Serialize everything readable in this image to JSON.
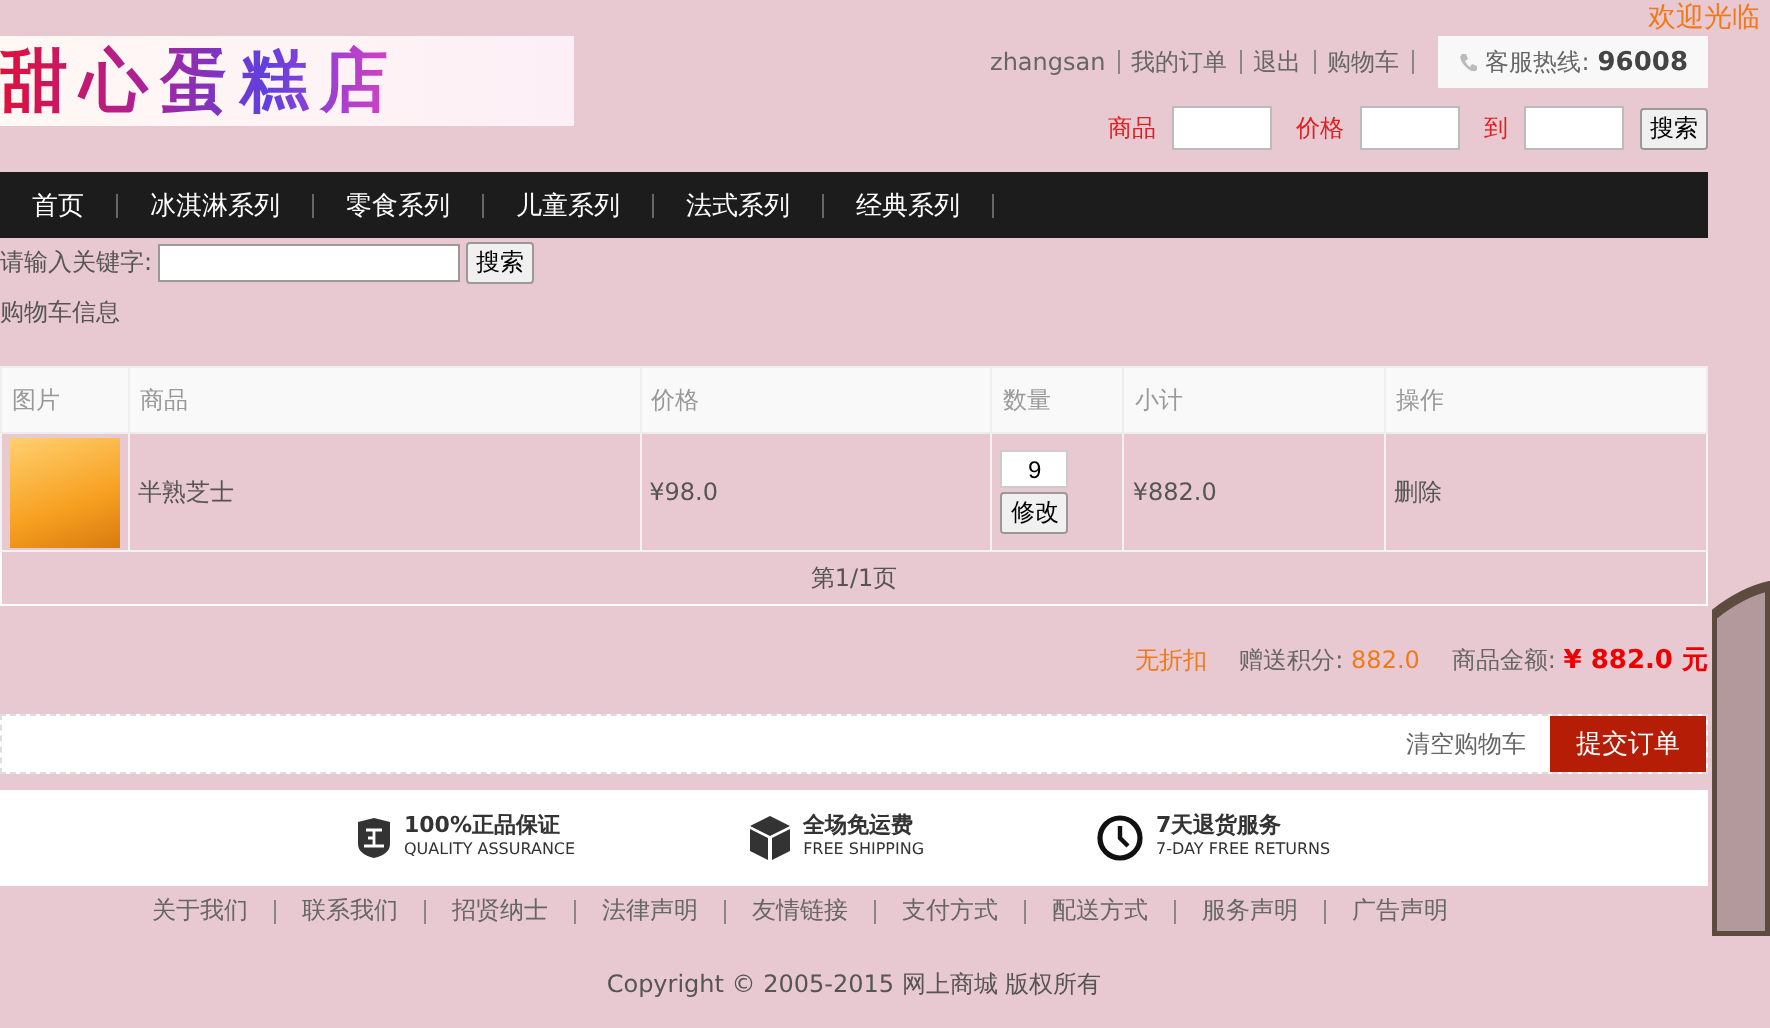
{
  "welcome": "欢迎光临",
  "logo": "甜心蛋糕店",
  "top_links": [
    "zhangsan",
    "我的订单",
    "退出",
    "购物车"
  ],
  "hotline": {
    "label": "客服热线:",
    "number": "96008"
  },
  "price_search": {
    "product_label": "商品",
    "price_label": "价格",
    "to_label": "到",
    "button": "搜索"
  },
  "nav": [
    {
      "label": "首页",
      "selected": false
    },
    {
      "label": "冰淇淋系列",
      "selected": false
    },
    {
      "label": "零食系列",
      "selected": false
    },
    {
      "label": "儿童系列",
      "selected": false
    },
    {
      "label": "法式系列",
      "selected": false
    },
    {
      "label": "经典系列",
      "selected": false
    }
  ],
  "keyword_search": {
    "label": "请输入关键字:",
    "button": "搜索"
  },
  "section_title": "购物车信息",
  "table": {
    "columns": [
      "图片",
      "商品",
      "价格",
      "数量",
      "小计",
      "操作"
    ],
    "rows": [
      {
        "name": "半熟芝士",
        "price": "¥98.0",
        "quantity": "9",
        "update": "修改",
        "subtotal": "¥882.0",
        "action": "删除"
      }
    ],
    "pager": "第1/1页"
  },
  "summary": {
    "discount": "无折扣",
    "points_label": "赠送积分:",
    "points": "882.0",
    "amount_label": "商品金额:",
    "amount": "¥ 882.0 元"
  },
  "actions": {
    "clear": "清空购物车",
    "submit": "提交订单"
  },
  "features": [
    {
      "kind": "shield",
      "title": "100%正品保证",
      "subtitle": "QUALITY ASSURANCE"
    },
    {
      "kind": "box",
      "title": "全场免运费",
      "subtitle": "FREE SHIPPING"
    },
    {
      "kind": "clock",
      "title": "7天退货服务",
      "subtitle": "7-DAY FREE RETURNS"
    }
  ],
  "footer_links": [
    "关于我们",
    "联系我们",
    "招贤纳士",
    "法律声明",
    "友情链接",
    "支付方式",
    "配送方式",
    "服务声明",
    "广告声明"
  ],
  "copyright": "Copyright © 2005-2015 网上商城 版权所有"
}
